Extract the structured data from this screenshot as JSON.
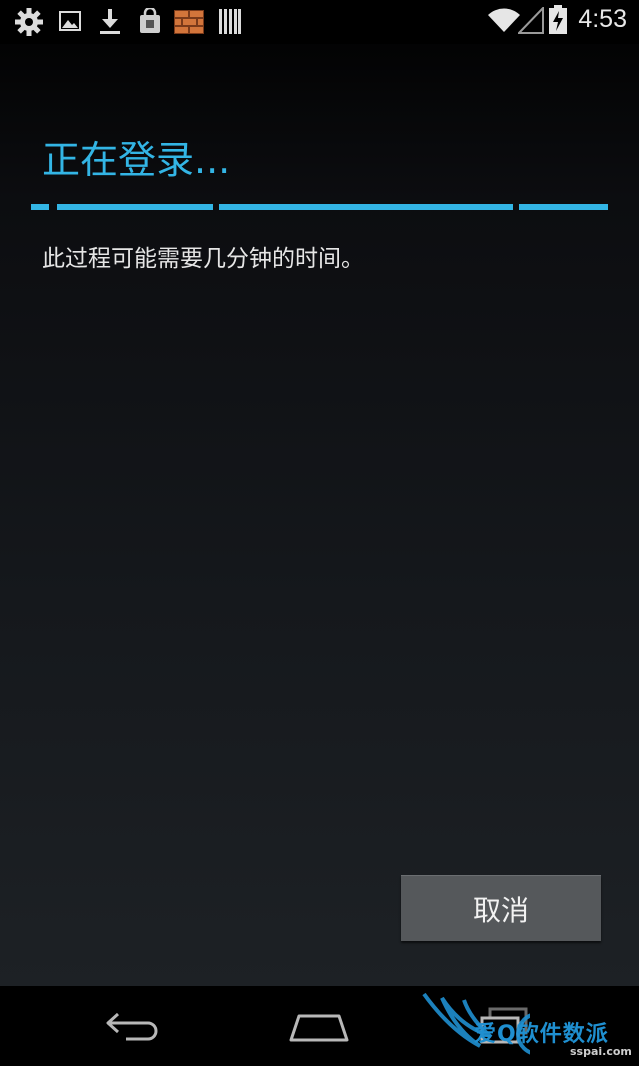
{
  "status_bar": {
    "time": "4:53",
    "left_icons": [
      "gear-icon",
      "image-icon",
      "download-icon",
      "shopping-bag-icon",
      "brick-wall-icon",
      "barcode-icon"
    ],
    "right_icons": [
      "wifi-icon",
      "signal-icon",
      "battery-charging-icon"
    ]
  },
  "dialog": {
    "title": "正在登录...",
    "message": "此过程可能需要几分钟的时间。",
    "cancel_label": "取消",
    "accent_color": "#33b5e5"
  },
  "nav_bar": {
    "buttons": [
      "back-icon",
      "home-icon",
      "recent-apps-icon"
    ]
  },
  "watermark": {
    "brand": "爱Q软件数派",
    "url": "sspai.com"
  }
}
